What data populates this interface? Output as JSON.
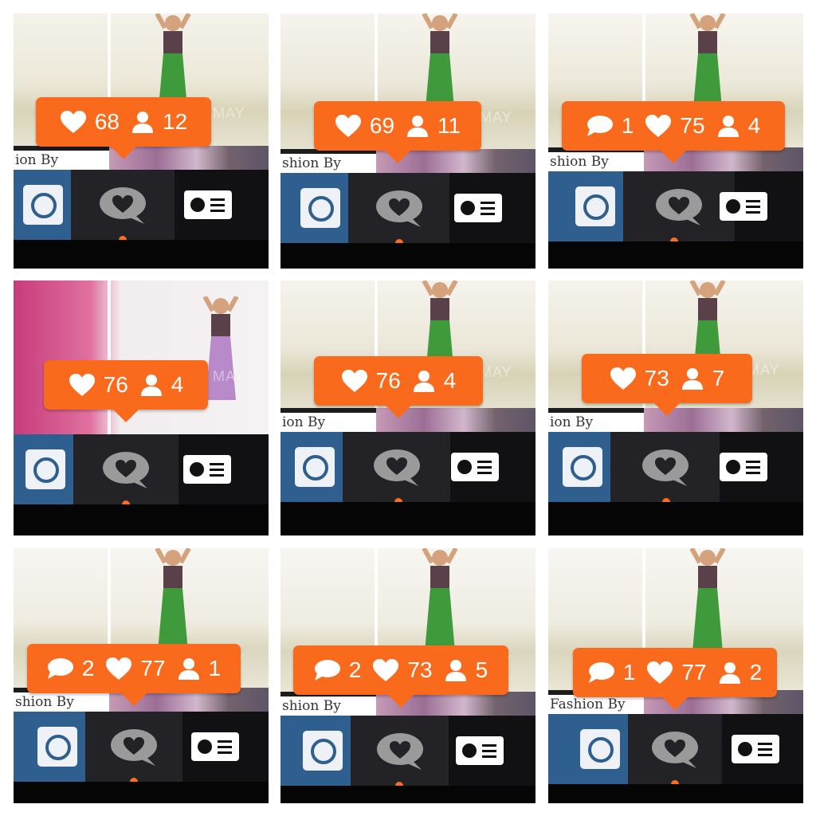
{
  "tiles": [
    {
      "caption": "ion By",
      "comments": null,
      "likes": "68",
      "followers": "12"
    },
    {
      "caption": "shion By",
      "comments": null,
      "likes": "69",
      "followers": "11"
    },
    {
      "caption": "shion By",
      "comments": "1",
      "likes": "75",
      "followers": "4"
    },
    {
      "caption": "",
      "comments": null,
      "likes": "76",
      "followers": "4"
    },
    {
      "caption": "ion By",
      "comments": null,
      "likes": "76",
      "followers": "4"
    },
    {
      "caption": "ion By",
      "comments": null,
      "likes": "73",
      "followers": "7"
    },
    {
      "caption": "shion By",
      "comments": "2",
      "likes": "77",
      "followers": "1"
    },
    {
      "caption": "shion By",
      "comments": "2",
      "likes": "73",
      "followers": "5"
    },
    {
      "caption": "Fashion By",
      "comments": "1",
      "likes": "77",
      "followers": "2"
    }
  ],
  "watermark": "MAY",
  "colors": {
    "bubble": "#fa6a1c",
    "indicator": "#ff6d1f",
    "instagram_tab": "#2e5f8e",
    "tabbar": "#1b1b1f"
  },
  "icons": {
    "comments": "speech-bubble-icon",
    "likes": "heart-icon",
    "followers": "person-icon",
    "home": "instagram-logo-icon",
    "activity": "heart-speech-bubble-icon",
    "profile": "profile-card-icon"
  }
}
